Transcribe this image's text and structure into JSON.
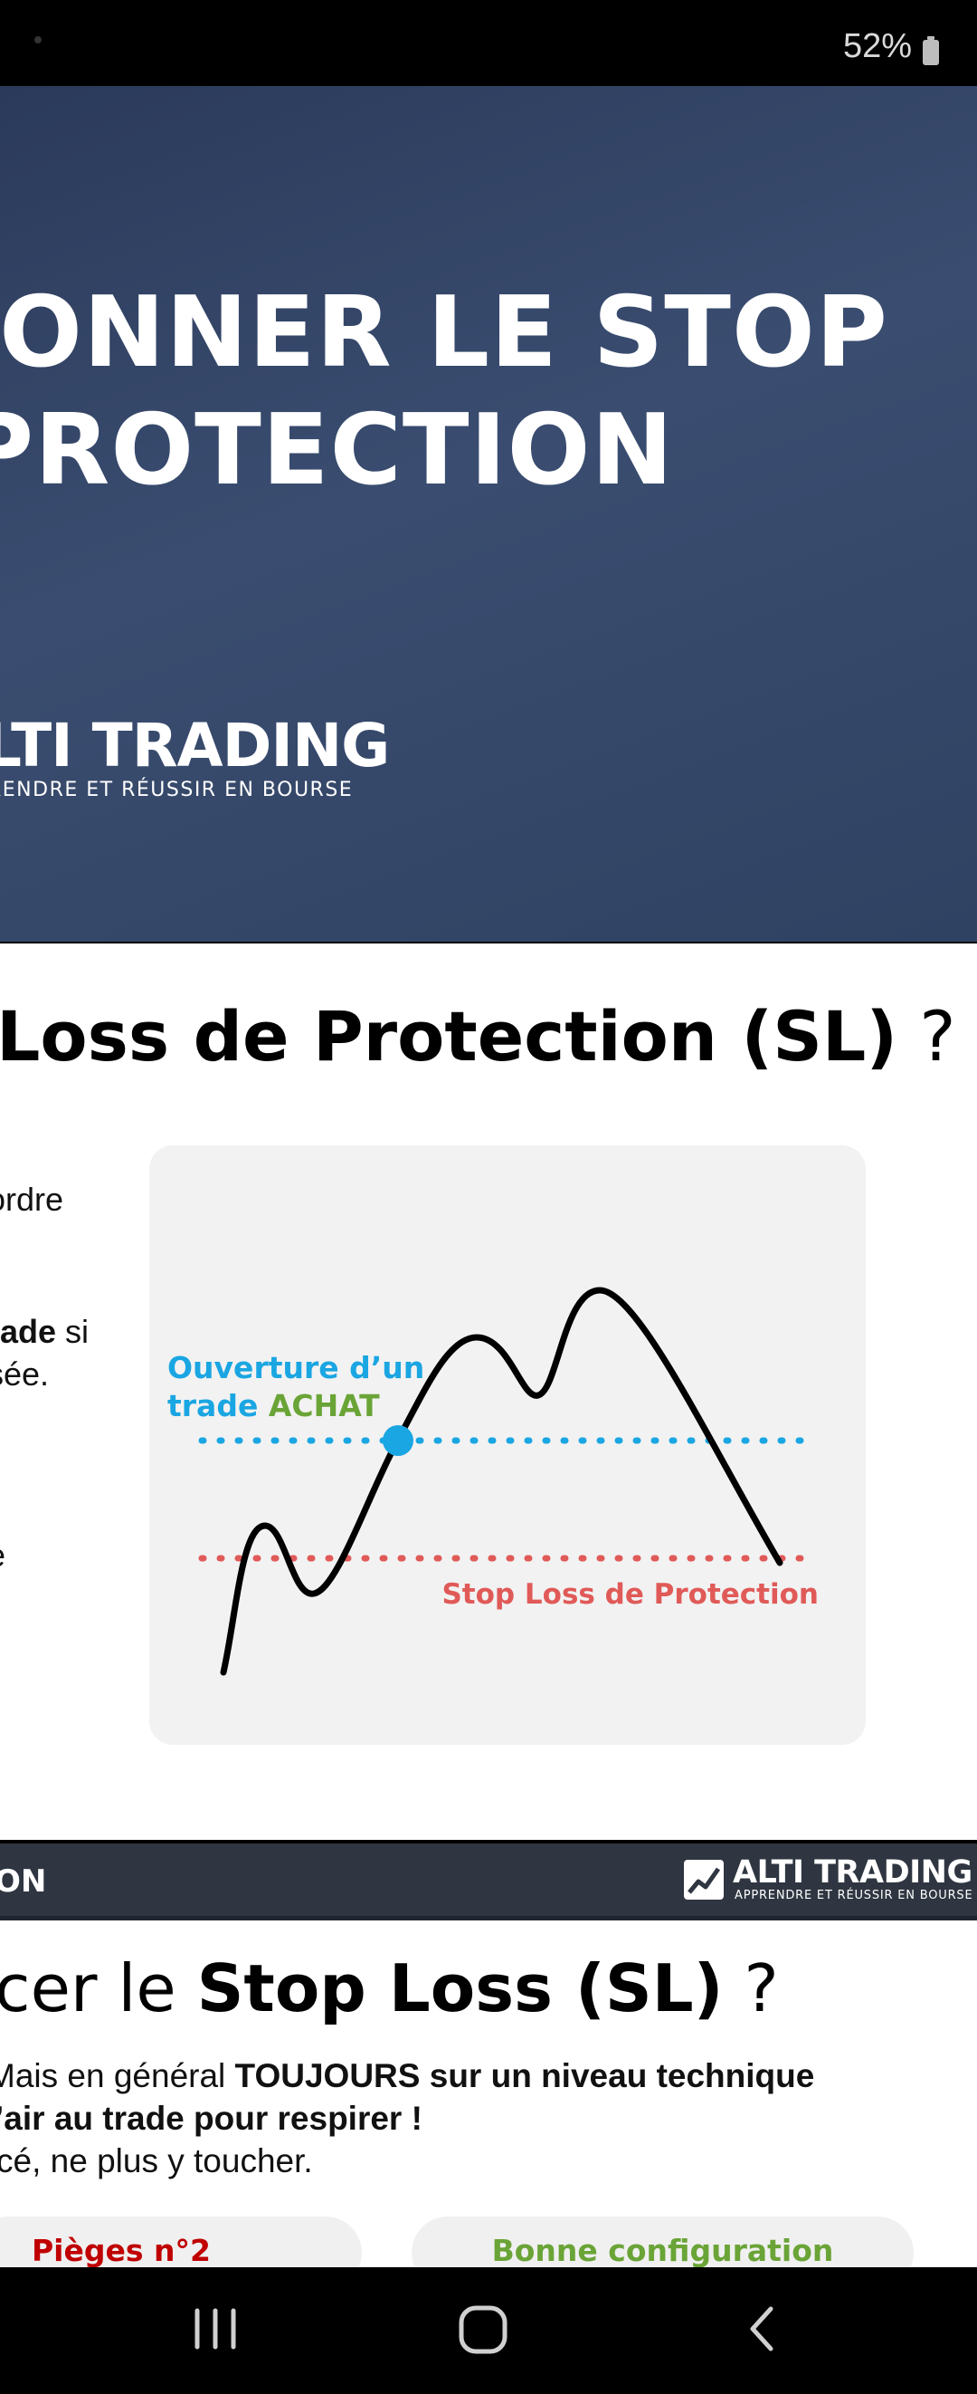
{
  "status_bar": {
    "battery": "52%"
  },
  "hero": {
    "title_line1": "IONNER LE STOP",
    "title_line2": " PROTECTION",
    "brand": "LTI TRADING",
    "tagline": "RENDRE ET RÉUSSIR EN BOURSE"
  },
  "definition": {
    "title_bold": "Loss de Protection (SL)",
    "title_rest": " ?",
    "text_line1": "ordre",
    "text_line2_bold": "rade",
    "text_line2_rest": " si",
    "text_line3": "sée.",
    "text_line4": "e",
    "chart": {
      "entry_label_line1": "Ouverture d’un",
      "entry_label_trade": "trade ",
      "entry_label_achat": "ACHAT",
      "stop_label": "Stop Loss de Protection",
      "colors": {
        "entry": "#1aa6e2",
        "achat": "#6aa437",
        "stop": "#e05a58"
      }
    }
  },
  "howto": {
    "header": "ON",
    "logo_name": "ALTI TRADING",
    "logo_tagline": "APPRENDRE ET RÉUSSIR EN BOURSE",
    "title_prefix": "cer le ",
    "title_bold": "Stop Loss (SL)",
    "title_suffix": " ?",
    "text_line1_prefix": "Mais en général ",
    "text_line1_bold": "TOUJOURS sur un niveau technique",
    "text_line2_bold": "’air au trade pour respirer !",
    "text_line3": "cé, ne plus y toucher.",
    "pill_traps": "Pièges n°2",
    "pill_good": "Bonne configuration"
  }
}
